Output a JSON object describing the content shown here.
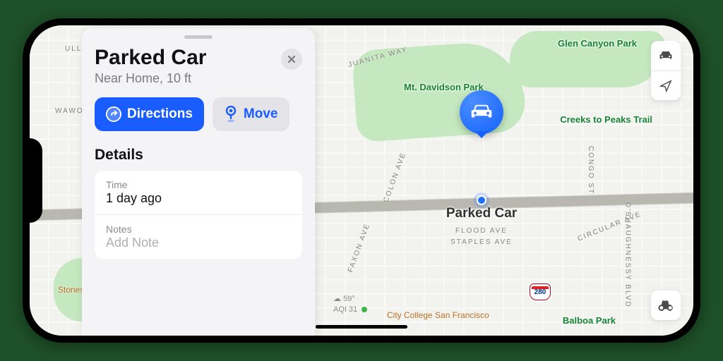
{
  "sheet": {
    "title": "Parked Car",
    "subtitle": "Near Home, 10 ft",
    "directions_label": "Directions",
    "move_label": "Move",
    "details_heading": "Details",
    "time_label": "Time",
    "time_value": "1 day ago",
    "notes_label": "Notes",
    "notes_placeholder": "Add Note"
  },
  "pin": {
    "label": "Parked Car",
    "sub1": "FLOOD AVE",
    "sub2": "STAPLES AVE"
  },
  "map_labels": {
    "glen_canyon": "Glen Canyon Park",
    "mt_davidson": "Mt. Davidson Park",
    "creeks": "Creeks to Peaks Trail",
    "city_college": "City College San Francisco",
    "stonestown": "Stonestown Galleria",
    "balboa": "Balboa Park",
    "shield_280": "280"
  },
  "streets": {
    "juanita": "JUANITA WAY",
    "colon": "COLON AVE",
    "congo": "CONGO ST",
    "circular": "CIRCULAR AVE",
    "faxon": "FAXON AVE",
    "ulloa": "ULLOA ST",
    "wawona": "WAWONA ST",
    "osh": "O'SHAUGHNESSY BLVD"
  },
  "weather": {
    "temp": "59°",
    "aqi_label": "AQI 31"
  }
}
